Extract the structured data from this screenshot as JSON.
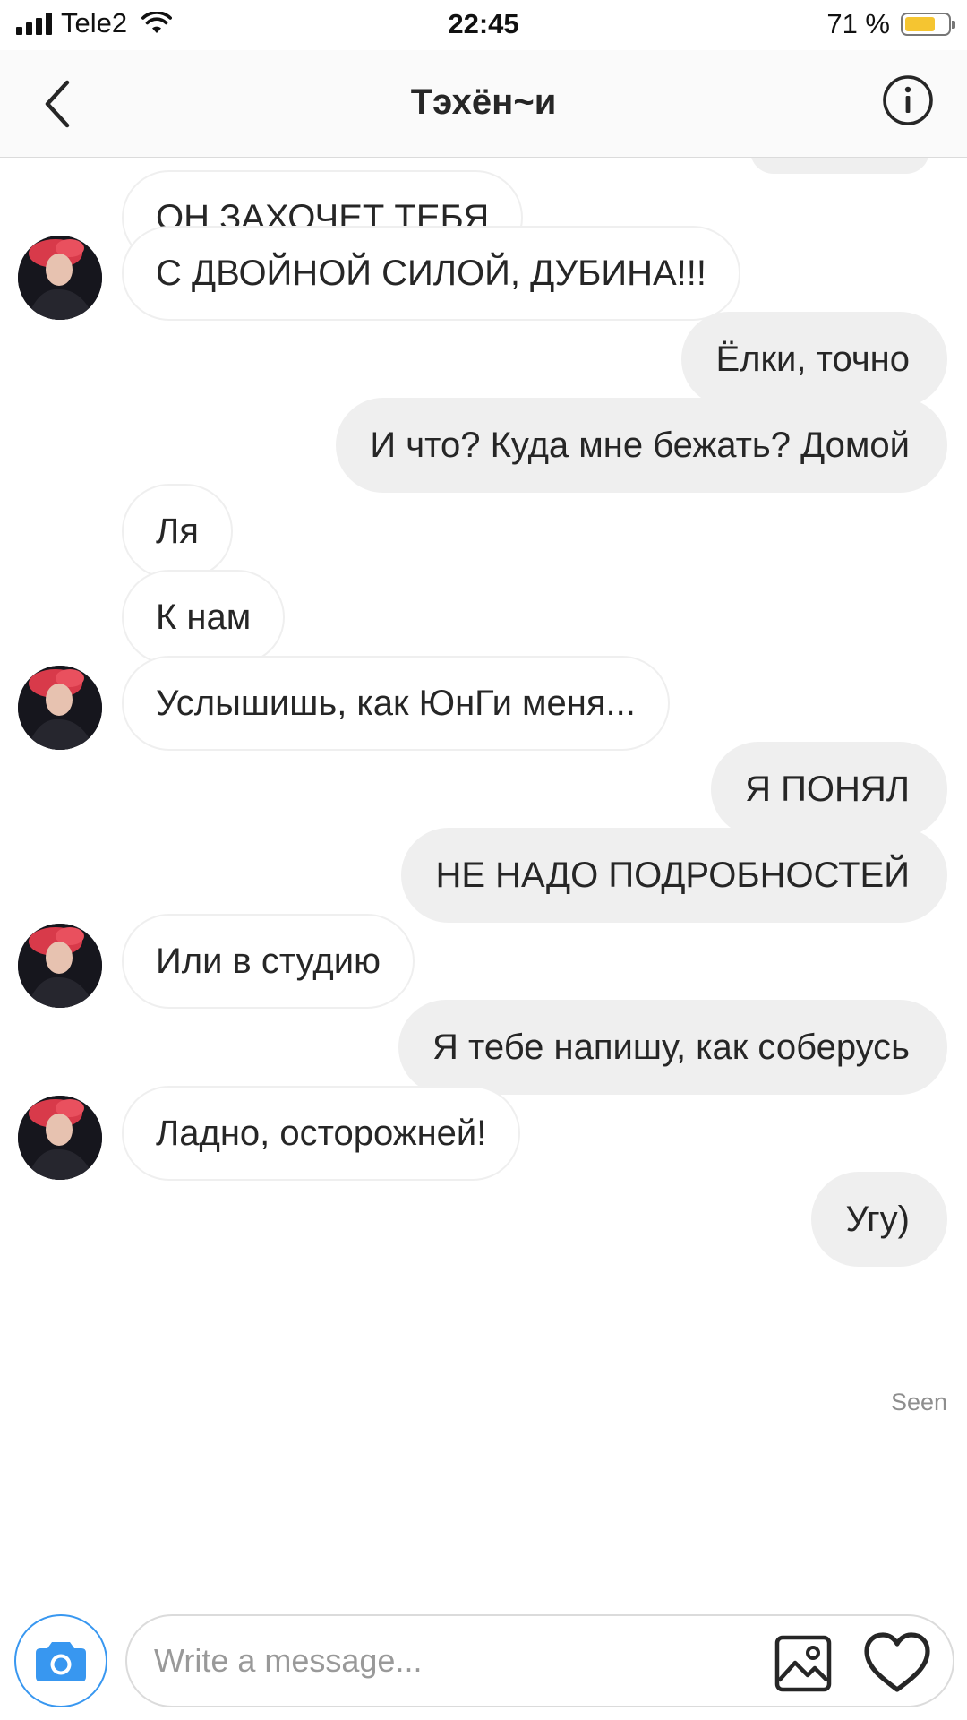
{
  "status_bar": {
    "carrier": "Tele2",
    "time": "22:45",
    "battery_text": "71 %",
    "battery_level": 0.71,
    "battery_color": "#f5c531"
  },
  "header": {
    "title": "Тэхён~и",
    "back_icon": "chevron-left-icon",
    "info_icon": "info-circle-icon"
  },
  "messages": [
    {
      "side": "in",
      "text": "ОН ЗАХОЧЕТ ТЕБЯ"
    },
    {
      "side": "in",
      "text": "С ДВОЙНОЙ СИЛОЙ, ДУБИНА!!!"
    },
    {
      "side": "out",
      "text": "Ёлки, точно"
    },
    {
      "side": "out",
      "text": "И что? Куда мне бежать? Домой"
    },
    {
      "side": "in",
      "text": "Ля"
    },
    {
      "side": "in",
      "text": "К нам"
    },
    {
      "side": "in",
      "text": "Услышишь, как ЮнГи меня..."
    },
    {
      "side": "out",
      "text": "Я ПОНЯЛ"
    },
    {
      "side": "out",
      "text": "НЕ НАДО ПОДРОБНОСТЕЙ"
    },
    {
      "side": "in",
      "text": "Или в студию"
    },
    {
      "side": "out",
      "text": "Я тебе напишу, как соберусь"
    },
    {
      "side": "in",
      "text": "Ладно, осторожней!"
    },
    {
      "side": "out",
      "text": "Угу)"
    }
  ],
  "seen_label": "Seen",
  "composer": {
    "placeholder": "Write a message...",
    "camera_icon": "camera-icon",
    "gallery_icon": "image-icon",
    "like_icon": "heart-icon",
    "accent_color": "#3897f0"
  }
}
